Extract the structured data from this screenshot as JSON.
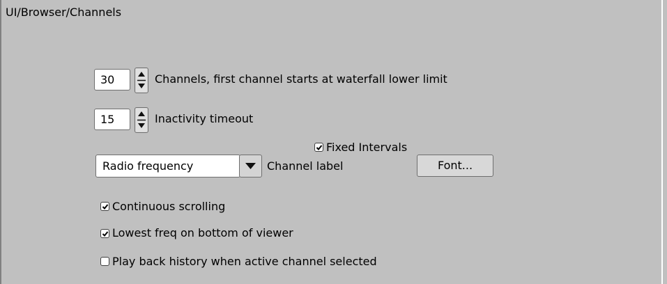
{
  "breadcrumb": "UI/Browser/Channels",
  "channels": {
    "value": "30",
    "label": "Channels, first channel starts at waterfall lower limit"
  },
  "inactivity": {
    "value": "15",
    "label": "Inactivity timeout"
  },
  "fixed_intervals": {
    "label": "Fixed Intervals",
    "checked": true
  },
  "channel_label": {
    "selected": "Radio frequency",
    "label": "Channel label"
  },
  "font_button": "Font...",
  "options": [
    {
      "label": "Continuous scrolling",
      "checked": true
    },
    {
      "label": "Lowest freq on bottom of viewer",
      "checked": true
    },
    {
      "label": "Play back history when active channel selected",
      "checked": false
    }
  ],
  "icons": {
    "spinner": "spinner-arrows-icon",
    "dropdown": "dropdown-arrow-icon",
    "check": "checkmark-icon"
  }
}
